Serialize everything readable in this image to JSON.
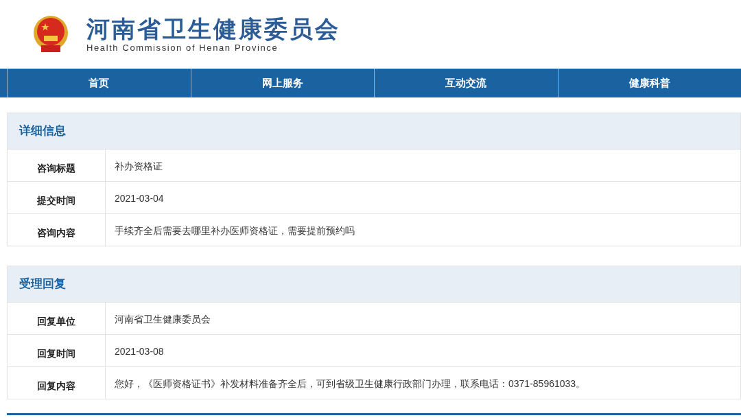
{
  "header": {
    "title": "河南省卫生健康委员会",
    "subtitle": "Health Commission of Henan Province"
  },
  "nav": [
    {
      "label": "首页"
    },
    {
      "label": "网上服务"
    },
    {
      "label": "互动交流"
    },
    {
      "label": "健康科普"
    }
  ],
  "sections": [
    {
      "title": "详细信息",
      "rows": [
        {
          "label": "咨询标题",
          "value": "补办资格证"
        },
        {
          "label": "提交时间",
          "value": "2021-03-04"
        },
        {
          "label": "咨询内容",
          "value": "手续齐全后需要去哪里补办医师资格证，需要提前预约吗"
        }
      ]
    },
    {
      "title": "受理回复",
      "rows": [
        {
          "label": "回复单位",
          "value": "河南省卫生健康委员会"
        },
        {
          "label": "回复时间",
          "value": "2021-03-08"
        },
        {
          "label": "回复内容",
          "value": "您好，《医师资格证书》补发材料准备齐全后，可到省级卫生健康行政部门办理，联系电话：0371-85961033。"
        }
      ]
    }
  ]
}
